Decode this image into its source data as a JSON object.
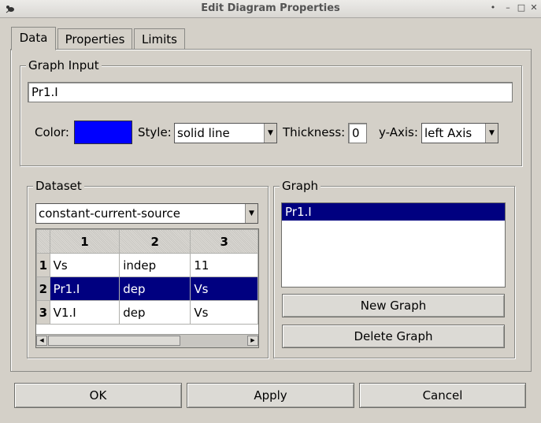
{
  "window": {
    "title": "Edit Diagram Properties",
    "controls": [
      "•",
      "–",
      "□",
      "✕"
    ]
  },
  "tabs": [
    {
      "label": "Data",
      "active": true
    },
    {
      "label": "Properties",
      "active": false
    },
    {
      "label": "Limits",
      "active": false
    }
  ],
  "graph_input": {
    "legend": "Graph Input",
    "value": "Pr1.I",
    "color_label": "Color:",
    "color_value": "#0000ff",
    "style_label": "Style:",
    "style_value": "solid line",
    "thickness_label": "Thickness:",
    "thickness_value": "0",
    "yaxis_label": "y-Axis:",
    "yaxis_value": "left Axis"
  },
  "dataset": {
    "legend": "Dataset",
    "selected": "constant-current-source",
    "columns": [
      "1",
      "2",
      "3"
    ],
    "rows": [
      {
        "num": "1",
        "cells": [
          "Vs",
          "indep",
          "11"
        ],
        "selected": false
      },
      {
        "num": "2",
        "cells": [
          "Pr1.I",
          "dep",
          "Vs"
        ],
        "selected": true
      },
      {
        "num": "3",
        "cells": [
          "V1.I",
          "dep",
          "Vs"
        ],
        "selected": false
      }
    ]
  },
  "graph": {
    "legend": "Graph",
    "items": [
      {
        "label": "Pr1.I",
        "selected": true
      }
    ],
    "new_button": "New Graph",
    "delete_button": "Delete Graph"
  },
  "footer": {
    "ok": "OK",
    "apply": "Apply",
    "cancel": "Cancel"
  }
}
